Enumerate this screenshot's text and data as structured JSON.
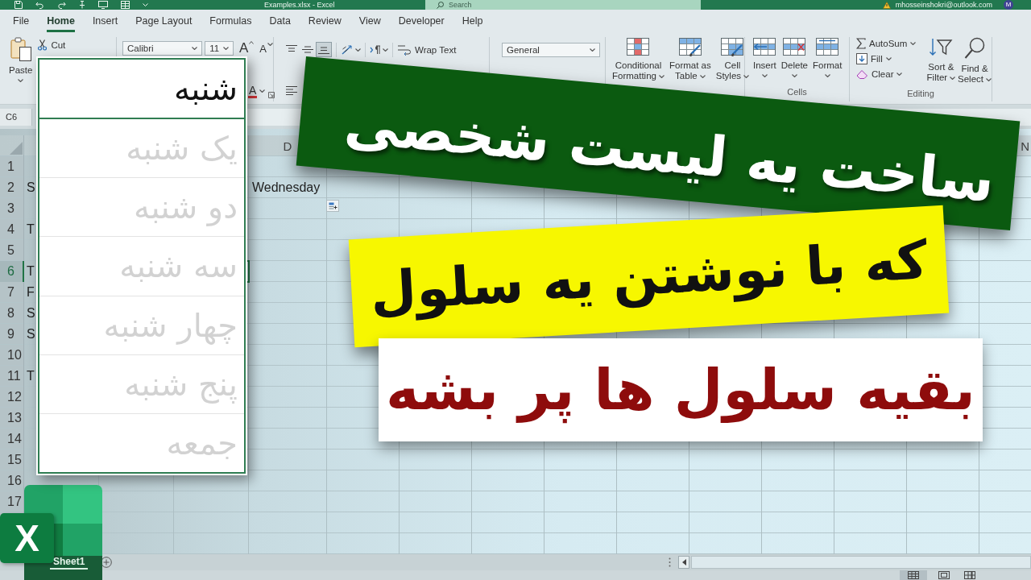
{
  "title_bar": {
    "document_title": "Examples.xlsx - Excel",
    "search": {
      "placeholder": "Search"
    },
    "account": "mhosseinshokri@outlook.com",
    "avatar": "M"
  },
  "menu_tabs": [
    {
      "label": "File",
      "selected": false
    },
    {
      "label": "Home",
      "selected": true
    },
    {
      "label": "Insert",
      "selected": false
    },
    {
      "label": "Page Layout",
      "selected": false
    },
    {
      "label": "Formulas",
      "selected": false
    },
    {
      "label": "Data",
      "selected": false
    },
    {
      "label": "Review",
      "selected": false
    },
    {
      "label": "View",
      "selected": false
    },
    {
      "label": "Developer",
      "selected": false
    },
    {
      "label": "Help",
      "selected": false
    }
  ],
  "ribbon": {
    "clipboard": {
      "paste": "Paste",
      "cut": "Cut"
    },
    "font": {
      "font_name": "Calibri",
      "font_size": "11",
      "grow": "A",
      "shrink": "A",
      "font_color": "A"
    },
    "alignment": {
      "vertical_align": [
        {
          "kind": "top",
          "selected": false
        },
        {
          "kind": "middle",
          "selected": false
        },
        {
          "kind": "bottom",
          "selected": true
        }
      ],
      "wrap_text": "Wrap Text"
    },
    "number": {
      "format": "General"
    },
    "styles": [
      {
        "kind": "conditional",
        "lines": [
          "Conditional",
          "Formatting"
        ]
      },
      {
        "kind": "table",
        "lines": [
          "Format as",
          "Table"
        ]
      },
      {
        "kind": "cell_styles",
        "lines": [
          "Cell",
          "Styles"
        ]
      }
    ],
    "cells": {
      "buttons": [
        {
          "kind": "insert",
          "label": "Insert"
        },
        {
          "kind": "delete",
          "label": "Delete"
        },
        {
          "kind": "format",
          "label": "Format"
        }
      ],
      "group_label": "Cells"
    },
    "editing": {
      "small_buttons": [
        {
          "kind": "autosum",
          "label": "AutoSum"
        },
        {
          "kind": "fill",
          "label": "Fill"
        },
        {
          "kind": "clear",
          "label": "Clear"
        }
      ],
      "big_buttons": [
        {
          "kind": "sort",
          "lines": [
            "Sort &",
            "Filter"
          ]
        },
        {
          "kind": "find",
          "lines": [
            "Find &",
            "Select"
          ]
        }
      ],
      "group_label": "Editing"
    }
  },
  "name_box": "C6",
  "custom_list": {
    "items": [
      {
        "label": "شنبه",
        "selected": true
      },
      {
        "label": "یک شنبه",
        "selected": false
      },
      {
        "label": "دو شنبه",
        "selected": false
      },
      {
        "label": "سه شنبه",
        "selected": false
      },
      {
        "label": "چهار شنبه",
        "selected": false
      },
      {
        "label": "پنج شنبه",
        "selected": false
      },
      {
        "label": "جمعه",
        "selected": false
      }
    ]
  },
  "headlines": [
    {
      "kind": "ribbon",
      "text": "ساخت یه لیست شخصی"
    },
    {
      "kind": "sticker",
      "text": "که با نوشتن یه سلول"
    },
    {
      "kind": "label",
      "text": "بقیه سلول ها پر بشه"
    }
  ],
  "sheet": {
    "column_headers": {
      "D": "D",
      "N": "N"
    },
    "rows": [
      {
        "number": "1",
        "selected": false
      },
      {
        "number": "2",
        "selected": false,
        "cells": {
          "A": "S",
          "D": "Wednesday"
        }
      },
      {
        "number": "3",
        "selected": false
      },
      {
        "number": "4",
        "selected": false,
        "cells": {
          "A": "T"
        }
      },
      {
        "number": "5",
        "selected": false
      },
      {
        "number": "6",
        "selected": true,
        "cells": {
          "A": "T"
        }
      },
      {
        "number": "7",
        "selected": false,
        "cells": {
          "A": "F"
        }
      },
      {
        "number": "8",
        "selected": false,
        "cells": {
          "A": "S"
        }
      },
      {
        "number": "9",
        "selected": false,
        "cells": {
          "A": "S"
        }
      },
      {
        "number": "10",
        "selected": false
      },
      {
        "number": "11",
        "selected": false,
        "cells": {
          "A": "T"
        }
      },
      {
        "number": "12",
        "selected": false
      },
      {
        "number": "13",
        "selected": false
      },
      {
        "number": "14",
        "selected": false
      },
      {
        "number": "15",
        "selected": false
      },
      {
        "number": "16",
        "selected": false
      },
      {
        "number": "17",
        "selected": false
      }
    ]
  },
  "app_logo": {
    "letter": "X"
  },
  "sheet_tabs": [
    {
      "label": "Sheet1",
      "selected": true
    }
  ],
  "view_buttons": [
    {
      "kind": "normal",
      "selected": true
    },
    {
      "kind": "page_layout",
      "selected": false
    },
    {
      "kind": "page_break",
      "selected": false
    }
  ]
}
